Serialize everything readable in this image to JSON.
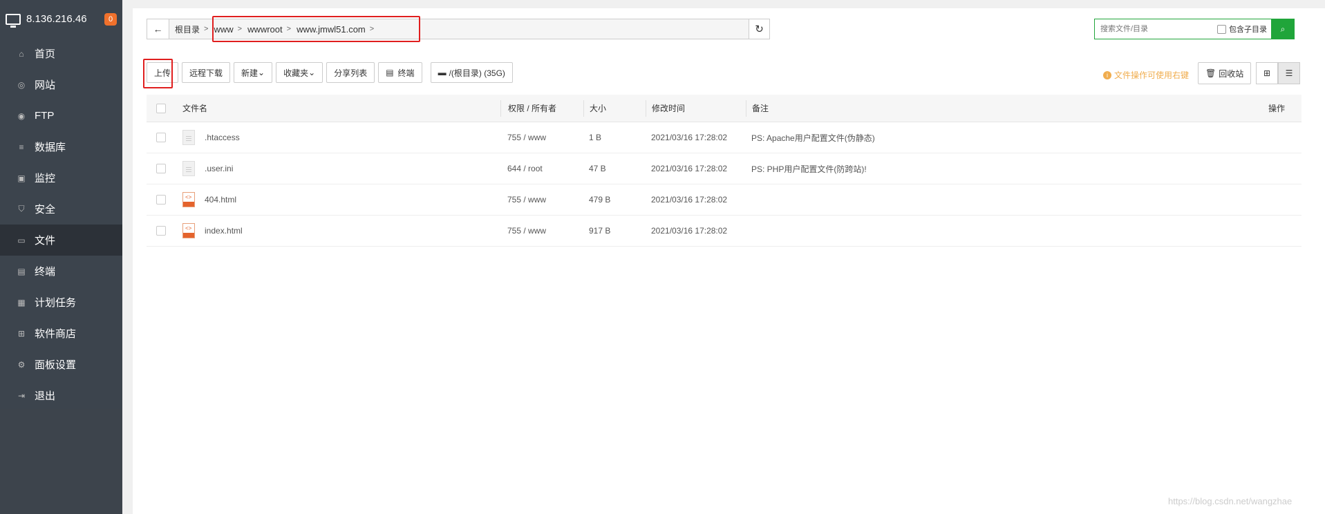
{
  "sidebar": {
    "ip": "8.136.216.46",
    "badge": "0",
    "items": [
      {
        "label": "首页",
        "icon": "home-icon"
      },
      {
        "label": "网站",
        "icon": "globe-icon"
      },
      {
        "label": "FTP",
        "icon": "ftp-icon"
      },
      {
        "label": "数据库",
        "icon": "database-icon"
      },
      {
        "label": "监控",
        "icon": "monitor-icon"
      },
      {
        "label": "安全",
        "icon": "shield-icon"
      },
      {
        "label": "文件",
        "icon": "folder-icon"
      },
      {
        "label": "终端",
        "icon": "terminal-icon"
      },
      {
        "label": "计划任务",
        "icon": "calendar-icon"
      },
      {
        "label": "软件商店",
        "icon": "apps-icon"
      },
      {
        "label": "面板设置",
        "icon": "settings-icon"
      },
      {
        "label": "退出",
        "icon": "logout-icon"
      }
    ],
    "active": "文件"
  },
  "breadcrumb": {
    "root": "根目录",
    "path": [
      "www",
      "wwwroot",
      "www.jmwl51.com"
    ]
  },
  "search": {
    "placeholder": "搜索文件/目录",
    "subdir_label": "包含子目录"
  },
  "toolbar": {
    "upload": "上传",
    "remote_download": "远程下载",
    "new": "新建",
    "favorites": "收藏夹",
    "share_list": "分享列表",
    "terminal": "终端",
    "disk": "/(根目录) (35G)"
  },
  "tip": "文件操作可使用右键",
  "recycle": "回收站",
  "table": {
    "headers": {
      "name": "文件名",
      "perm": "权限 / 所有者",
      "size": "大小",
      "time": "修改时间",
      "note": "备注",
      "op": "操作"
    },
    "rows": [
      {
        "name": ".htaccess",
        "type": "txt",
        "perm": "755 / www",
        "size": "1 B",
        "time": "2021/03/16 17:28:02",
        "note": "PS: Apache用户配置文件(伪静态)"
      },
      {
        "name": ".user.ini",
        "type": "txt",
        "perm": "644 / root",
        "size": "47 B",
        "time": "2021/03/16 17:28:02",
        "note": "PS: PHP用户配置文件(防跨站)!"
      },
      {
        "name": "404.html",
        "type": "html",
        "perm": "755 / www",
        "size": "479 B",
        "time": "2021/03/16 17:28:02",
        "note": ""
      },
      {
        "name": "index.html",
        "type": "html",
        "perm": "755 / www",
        "size": "917 B",
        "time": "2021/03/16 17:28:02",
        "note": ""
      }
    ]
  },
  "watermark": "https://blog.csdn.net/wangzhae",
  "colors": {
    "accent": "#20a53a",
    "highlight": "#e01e1e",
    "sidebar": "#3c444d"
  }
}
